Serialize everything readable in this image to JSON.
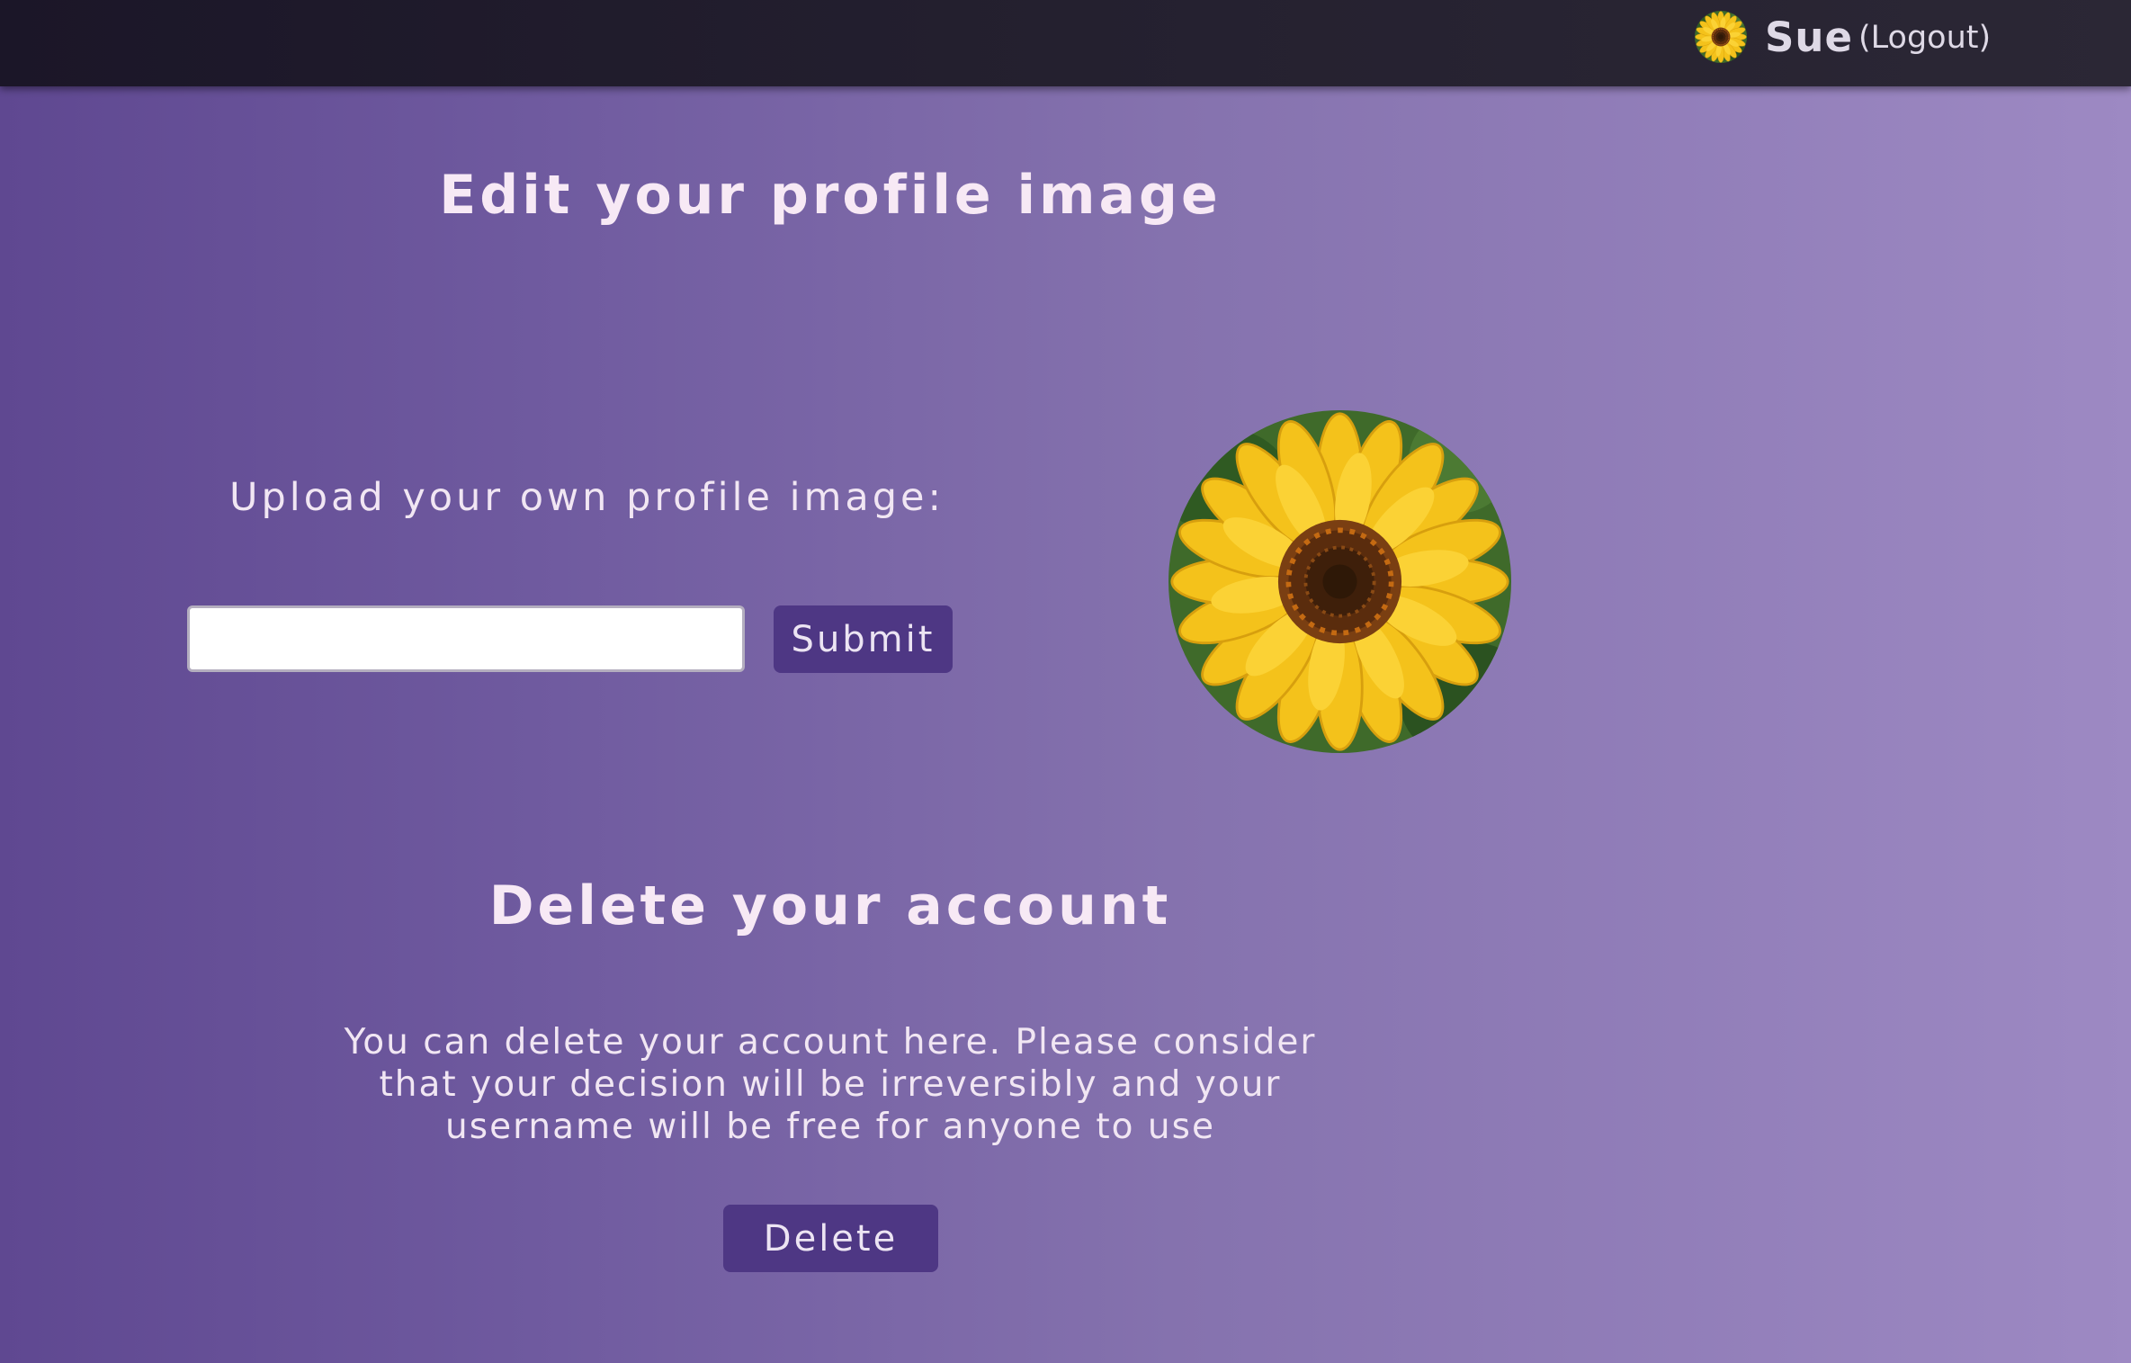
{
  "header": {
    "username": "Sue",
    "logout_label": "(Logout)",
    "avatar_icon": "sunflower-avatar-icon"
  },
  "profile_section": {
    "title": "Edit your profile image",
    "upload_label": "Upload your own profile image:",
    "input_value": "",
    "submit_label": "Submit",
    "image_icon": "sunflower-image"
  },
  "delete_section": {
    "title": "Delete your account",
    "description": "You can delete your account here. Please consider that your decision will be irreversibly and your username will be free for anyone to use",
    "delete_label": "Delete"
  },
  "colors": {
    "background_start": "#5f4891",
    "background_end": "#9d89c3",
    "topbar": "#211c2c",
    "button": "#4e3784",
    "text": "#f3e8f5"
  }
}
